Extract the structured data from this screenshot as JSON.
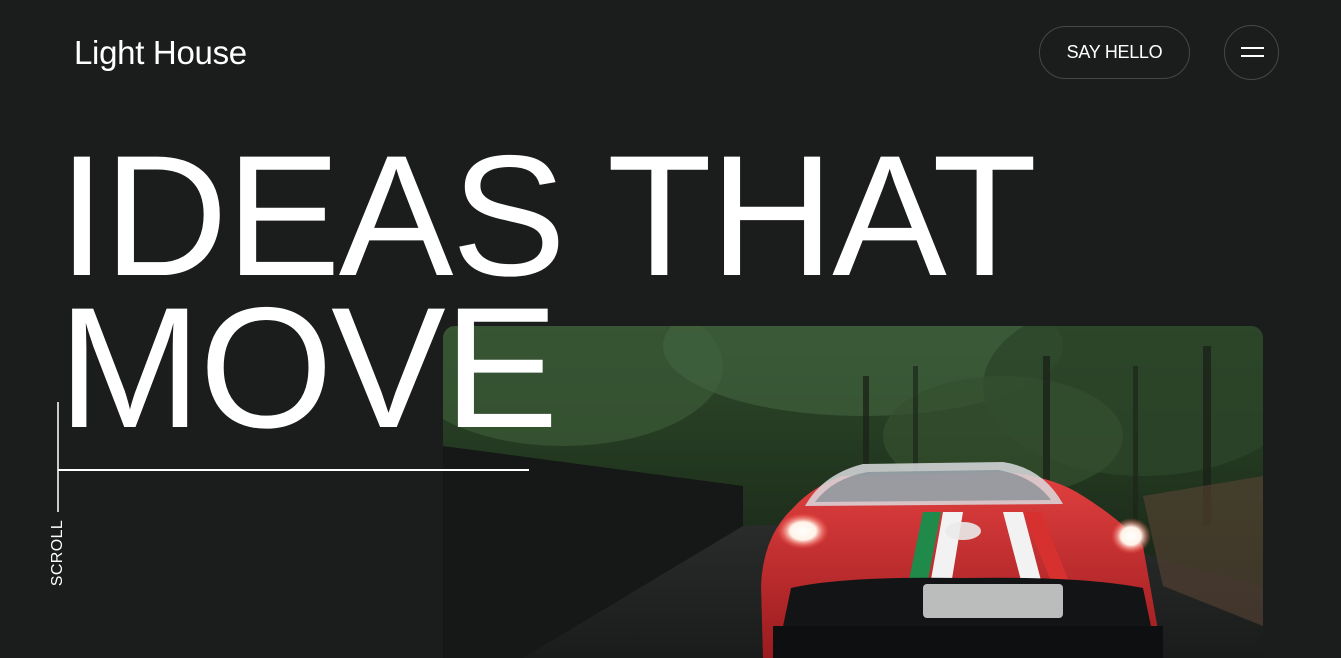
{
  "header": {
    "logo": "Light House",
    "say_hello_label": "SAY HELLO",
    "menu_icon": "hamburger-menu-icon"
  },
  "hero": {
    "headline_line1": "IDEAS THAT",
    "headline_line2": "MOVE",
    "scroll_label": "SCROLL",
    "media_description_icon": "hero-video"
  },
  "colors": {
    "background": "#1b1c1c",
    "text": "#ffffff",
    "button_border": "#464848"
  }
}
